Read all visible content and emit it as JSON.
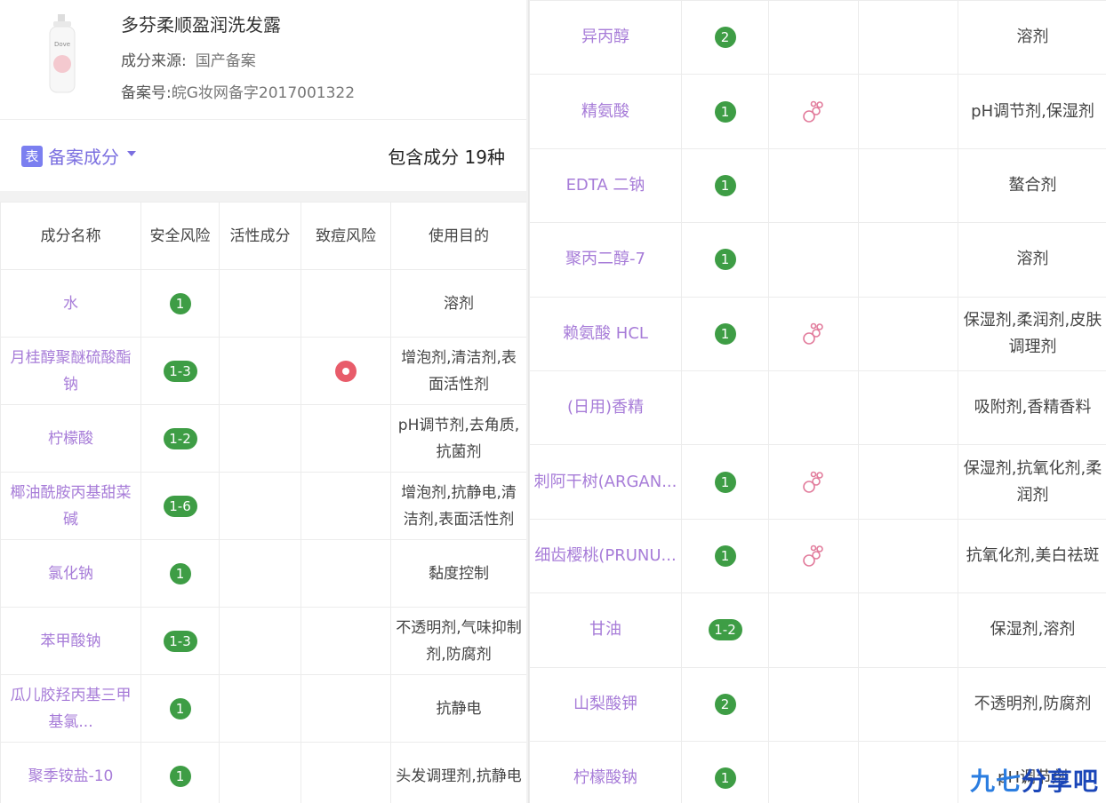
{
  "product": {
    "title": "多芬柔顺盈润洗发露",
    "source_label": "成分来源:",
    "source_value": "国产备案",
    "record_label": "备案号:",
    "record_value": "皖G妆网备字2017001322"
  },
  "section": {
    "icon_text": "表",
    "title": "备案成分",
    "count_text": "包含成分 19种"
  },
  "table": {
    "headers": [
      "成分名称",
      "安全风险",
      "活性成分",
      "致痘风险",
      "使用目的"
    ]
  },
  "left_rows": [
    {
      "name": "水",
      "risk": "1",
      "active": false,
      "acne": false,
      "purpose": "溶剂"
    },
    {
      "name": "月桂醇聚醚硫酸酯钠",
      "risk": "1-3",
      "active": false,
      "acne": true,
      "purpose": "增泡剂,清洁剂,表面活性剂"
    },
    {
      "name": "柠檬酸",
      "risk": "1-2",
      "active": false,
      "acne": false,
      "purpose": "pH调节剂,去角质,抗菌剂"
    },
    {
      "name": "椰油酰胺丙基甜菜碱",
      "risk": "1-6",
      "active": false,
      "acne": false,
      "purpose": "增泡剂,抗静电,清洁剂,表面活性剂"
    },
    {
      "name": "氯化钠",
      "risk": "1",
      "active": false,
      "acne": false,
      "purpose": "黏度控制"
    },
    {
      "name": "苯甲酸钠",
      "risk": "1-3",
      "active": false,
      "acne": false,
      "purpose": "不透明剂,气味抑制剂,防腐剂"
    },
    {
      "name": "瓜儿胶羟丙基三甲基氯...",
      "risk": "1",
      "active": false,
      "acne": false,
      "purpose": "抗静电"
    },
    {
      "name": "聚季铵盐-10",
      "risk": "1",
      "active": false,
      "acne": false,
      "purpose": "头发调理剂,抗静电"
    }
  ],
  "right_rows": [
    {
      "name": "异丙醇",
      "risk": "2",
      "active": false,
      "acne": false,
      "purpose": "溶剂"
    },
    {
      "name": "精氨酸",
      "risk": "1",
      "active": true,
      "acne": false,
      "purpose": "pH调节剂,保湿剂"
    },
    {
      "name": "EDTA 二钠",
      "risk": "1",
      "active": false,
      "acne": false,
      "purpose": "螯合剂"
    },
    {
      "name": "聚丙二醇-7",
      "risk": "1",
      "active": false,
      "acne": false,
      "purpose": "溶剂"
    },
    {
      "name": "赖氨酸 HCL",
      "risk": "1",
      "active": true,
      "acne": false,
      "purpose": "保湿剂,柔润剂,皮肤调理剂"
    },
    {
      "name": "(日用)香精",
      "risk": "",
      "active": false,
      "acne": false,
      "purpose": "吸附剂,香精香料"
    },
    {
      "name": "刺阿干树(ARGAN...",
      "risk": "1",
      "active": true,
      "acne": false,
      "purpose": "保湿剂,抗氧化剂,柔润剂"
    },
    {
      "name": "细齿樱桃(PRUNU...",
      "risk": "1",
      "active": true,
      "acne": false,
      "purpose": "抗氧化剂,美白祛斑"
    },
    {
      "name": "甘油",
      "risk": "1-2",
      "active": false,
      "acne": false,
      "purpose": "保湿剂,溶剂"
    },
    {
      "name": "山梨酸钾",
      "risk": "2",
      "active": false,
      "acne": false,
      "purpose": "不透明剂,防腐剂"
    },
    {
      "name": "柠檬酸钠",
      "risk": "1",
      "active": false,
      "acne": false,
      "purpose": "pH调节剂"
    }
  ],
  "watermark": {
    "a": "九七",
    "b": "分享吧"
  },
  "colors": {
    "accent": "#7b6fe0",
    "name_purple": "#a77cd8",
    "risk_green": "#3e9d45",
    "acne_red": "#e85c6a"
  }
}
